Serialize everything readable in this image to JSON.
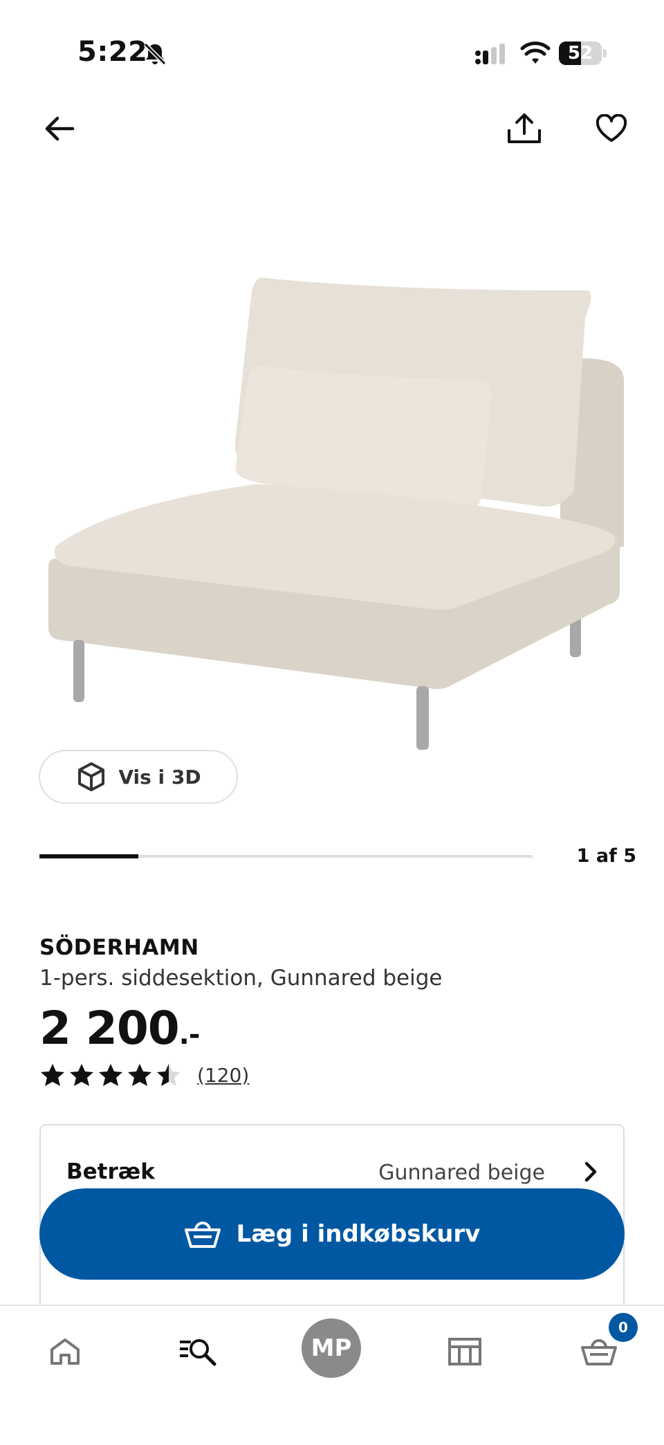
{
  "status_bar": {
    "time": "5:22",
    "battery": "52",
    "battery_level": 0.52
  },
  "header": {
    "back_icon": "arrow-left-icon",
    "share_icon": "share-icon",
    "favorite_icon": "heart-icon"
  },
  "gallery": {
    "view_3d_label": "Vis i 3D",
    "counter": "1 af 5",
    "current": 1,
    "total": 5
  },
  "product": {
    "name": "SÖDERHAMN",
    "description": "1-pers. siddesektion, Gunnared beige",
    "price_main": "2 200",
    "price_suffix": ".-",
    "rating": 4.5,
    "rating_max": 5,
    "review_count": "(120)"
  },
  "options": {
    "cover_label": "Betræk",
    "cover_value": "Gunnared beige"
  },
  "cart_button": {
    "label": "Læg i indkøbskurv"
  },
  "bottom_nav": {
    "profile_initials": "MP",
    "cart_badge": "0"
  },
  "colors": {
    "accent": "#0058a3",
    "upholstery": "#e3ddd3",
    "profile_bg": "#8a8a8a"
  }
}
